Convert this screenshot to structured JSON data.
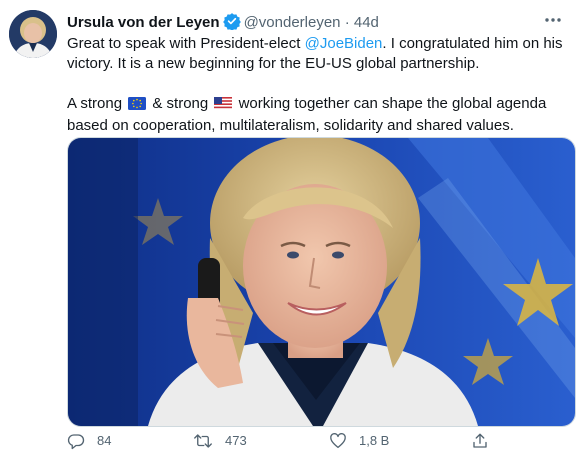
{
  "tweet": {
    "author_name": "Ursula von der Leyen",
    "handle": "@vonderleyen",
    "separator": "·",
    "time": "44d",
    "text": {
      "p1_before": "Great to speak with President-elect ",
      "mention": "@JoeBiden",
      "p1_after": ". I congratulated him on his victory. It is a new beginning for the EU-US global partnership.",
      "p2_a": "A strong ",
      "p2_b": " & strong ",
      "p2_c": " working together can shape the global agenda based on cooperation, multilateralism, solidarity and shared values."
    },
    "icons": {
      "verified": "verified-badge-icon",
      "more": "more-options-icon",
      "flag_eu": "eu-flag-icon",
      "flag_us": "us-flag-icon",
      "reply": "reply-icon",
      "retweet": "retweet-icon",
      "like": "like-icon",
      "share": "share-icon"
    },
    "actions": {
      "replies": "84",
      "retweets": "473",
      "likes": "1,8 B"
    },
    "colors": {
      "accent": "#1d9bf0",
      "secondary_text": "#536471",
      "primary_text": "#0f1419"
    }
  }
}
